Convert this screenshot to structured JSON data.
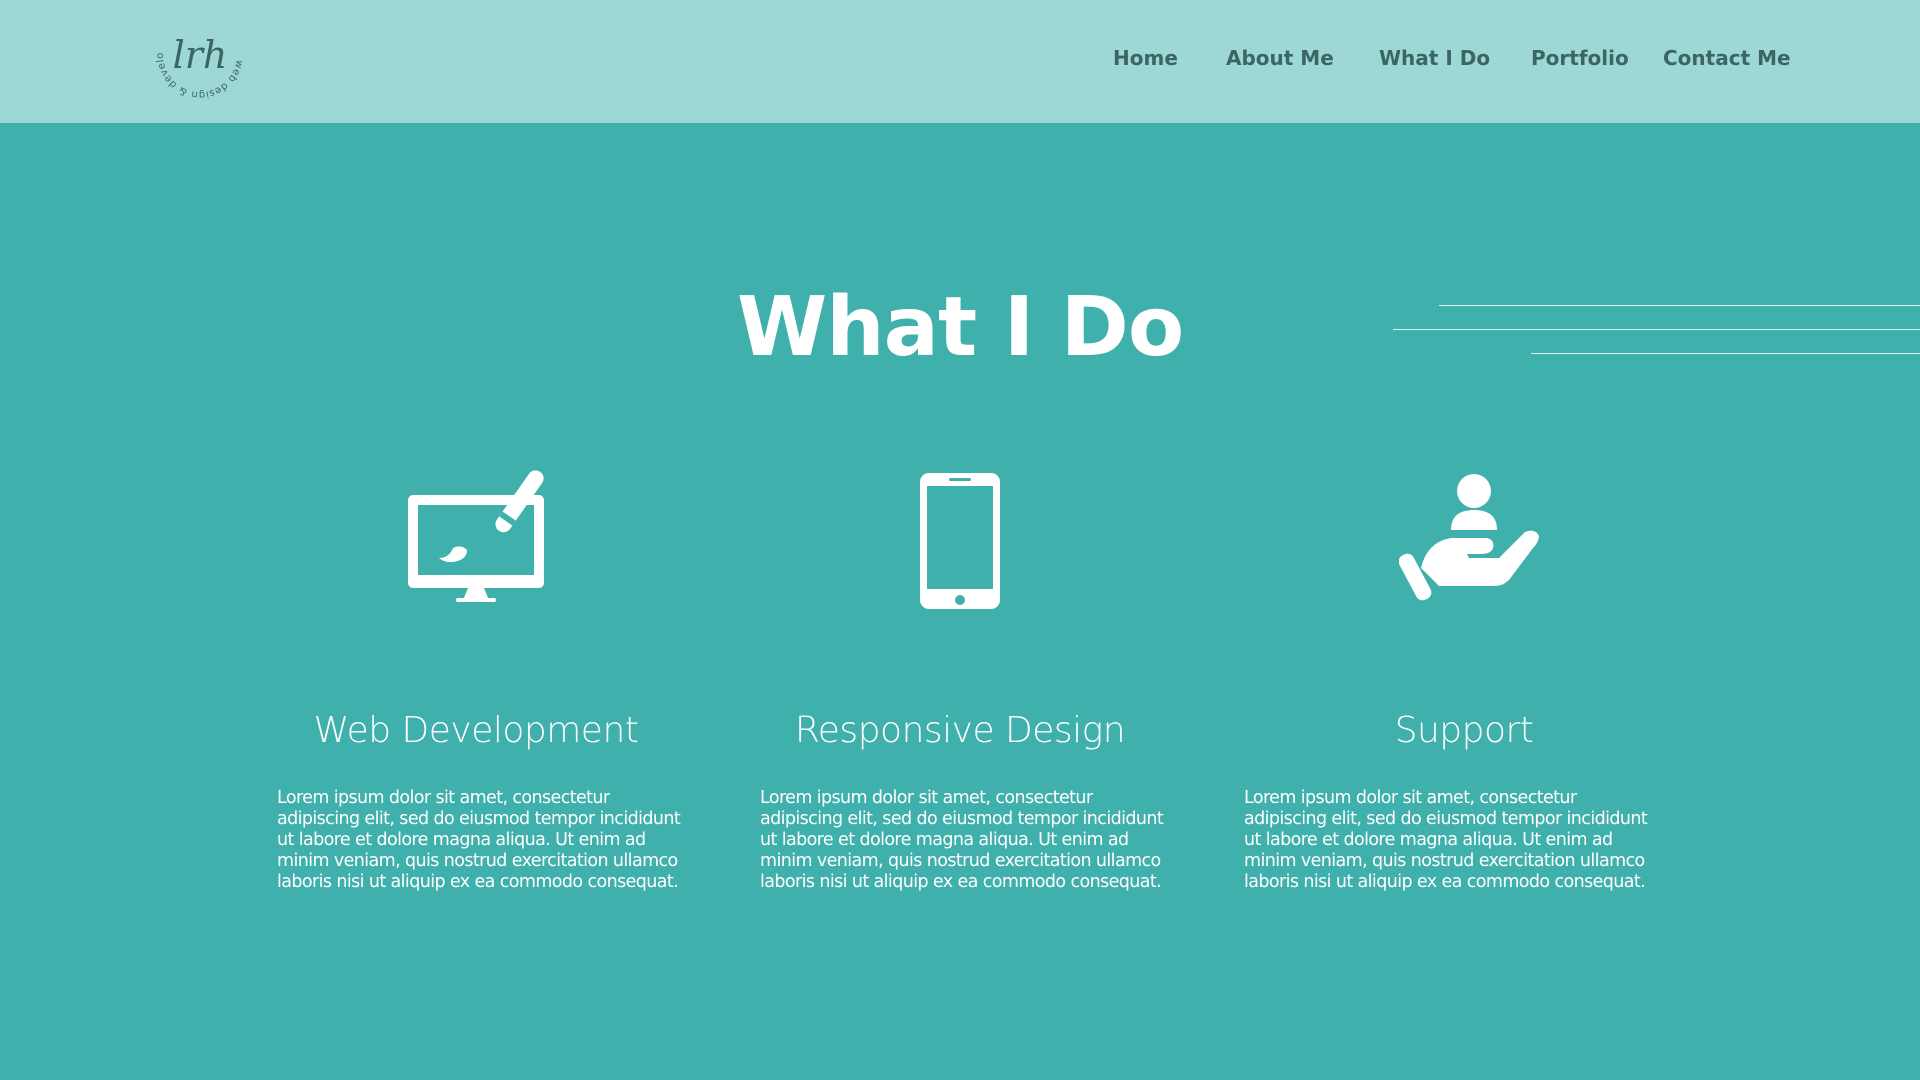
{
  "brand": {
    "monogram": "lrh",
    "ring_text": "web design & development",
    "logo_color": "#3b6663"
  },
  "nav": {
    "items": [
      {
        "label": "Home"
      },
      {
        "label": "About Me"
      },
      {
        "label": "What I Do"
      },
      {
        "label": "Portfolio"
      },
      {
        "label": "Contact Me"
      }
    ]
  },
  "section": {
    "title": "What I Do"
  },
  "services": [
    {
      "icon": "monitor-paintbrush-icon",
      "heading": "Web Development",
      "body": "Lorem ipsum dolor sit amet, consectetur adipiscing elit, sed do eiusmod tempor incididunt ut labore et dolore magna aliqua. Ut enim ad minim veniam, quis nostrud exercitation ullamco laboris nisi ut aliquip ex ea commodo consequat."
    },
    {
      "icon": "smartphone-icon",
      "heading": "Responsive Design",
      "body": "Lorem ipsum dolor sit amet, consectetur adipiscing elit, sed do eiusmod tempor incididunt ut labore et dolore magna aliqua. Ut enim ad minim veniam, quis nostrud exercitation ullamco laboris nisi ut aliquip ex ea commodo consequat."
    },
    {
      "icon": "hand-person-support-icon",
      "heading": "Support",
      "body": "Lorem ipsum dolor sit amet, consectetur adipiscing elit, sed do eiusmod tempor incididunt ut labore et dolore magna aliqua. Ut enim ad minim veniam, quis nostrud exercitation ullamco laboris nisi ut aliquip ex ea commodo consequat."
    }
  ],
  "colors": {
    "header_bg": "#9ed8d6",
    "page_bg": "#40b0ac",
    "nav_text": "#3b6663",
    "content_text": "#ffffff"
  }
}
